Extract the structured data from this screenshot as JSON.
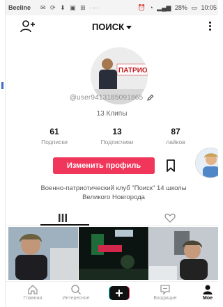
{
  "status_bar": {
    "carrier": "Beeline",
    "battery": "28%",
    "time": "10:05"
  },
  "header": {
    "title": "ПОИСК"
  },
  "profile": {
    "avatar_text": "ПАТРИОТ",
    "username": "@user9413185091865",
    "clips": "13 Клипы",
    "bio": "Военно-патриотический клуб \"Поиск\" 14 школы Великого Новгорода"
  },
  "stats": [
    {
      "value": "61",
      "label": "Подписки"
    },
    {
      "value": "13",
      "label": "Подписчики"
    },
    {
      "value": "87",
      "label": "лайков"
    }
  ],
  "actions": {
    "edit_profile": "Изменить профиль"
  },
  "nav": {
    "home": "Главная",
    "discover": "Интересное",
    "inbox": "Входящие",
    "me": "Мое"
  },
  "colors": {
    "accent": "#f0365a",
    "text": "#111111",
    "muted": "#8a8a8a"
  }
}
